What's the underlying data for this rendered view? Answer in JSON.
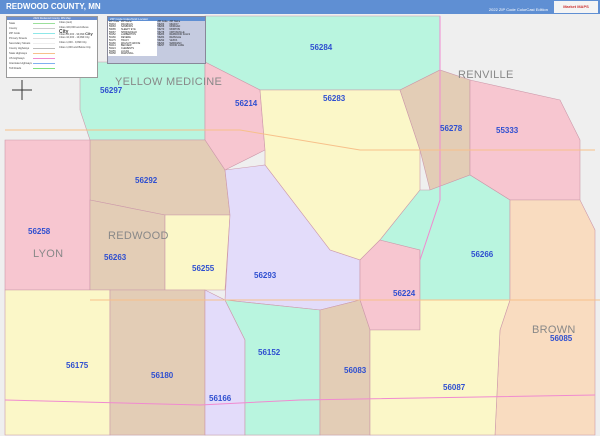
{
  "header": {
    "title": "REDWOOD COUNTY, MN",
    "edition": "2022 ZIP Code ColorCast Edition",
    "logo": "Market MAPS"
  },
  "legend": {
    "title": "2022 Redwood County, MN Map",
    "items": [
      {
        "label": "State",
        "color": "#9be09b"
      },
      {
        "label": "County",
        "color": "#cccccc"
      },
      {
        "label": "ZIP Code",
        "color": "#8ee8e8"
      },
      {
        "label": "Primary Streets",
        "color": "#dddddd"
      },
      {
        "label": "Secondary Streets",
        "color": "#eeeeee"
      },
      {
        "label": "County Highways",
        "color": "#bbbbbb"
      },
      {
        "label": "State Highways",
        "color": "#f7c08a"
      },
      {
        "label": "US Highways",
        "color": "#f08ad0"
      },
      {
        "label": "Interstate Highways",
        "color": "#7fb0f0"
      },
      {
        "label": "Toll Roads",
        "color": "#7fe07f"
      }
    ],
    "cities": [
      {
        "label": "Cities (text)",
        "sample": ""
      },
      {
        "label": "Cities 100,000 and Above",
        "sample": "City"
      },
      {
        "label": "Cities 20,000 - 99,999",
        "sample": "City"
      },
      {
        "label": "Cities 10,000 - 19,999",
        "sample": "City"
      },
      {
        "label": "Cities 1,000 - 9,999",
        "sample": "City"
      },
      {
        "label": "Cities 1,000 and Below",
        "sample": "City"
      }
    ]
  },
  "zip_table": {
    "title": "ZIP Code Index/Grid Locator",
    "headers": [
      "ZIP Code",
      "ZIP Name"
    ],
    "left": [
      [
        "55333",
        "FRANKLIN"
      ],
      [
        "56083",
        "SANBORN"
      ],
      [
        "56085",
        "SLEEPY EYE"
      ],
      [
        "56087",
        "SPRINGFIELD"
      ],
      [
        "56152",
        "LAMBERTON"
      ],
      [
        "56166",
        "REVERE"
      ],
      [
        "56175",
        "TRACY"
      ],
      [
        "56180",
        "WALNUT GROVE"
      ],
      [
        "56214",
        "BELVIEW"
      ],
      [
        "56224",
        "CLEMENTS"
      ],
      [
        "56255",
        "LUCAN"
      ],
      [
        "56258",
        "MARSHALL"
      ]
    ],
    "right": [
      [
        "56263",
        "MILROY"
      ],
      [
        "56266",
        "MORGAN"
      ],
      [
        "56270",
        "MORTON"
      ],
      [
        "56278",
        "ORTONVILLE"
      ],
      [
        "56283",
        "REDWOOD FALLS"
      ],
      [
        "56284",
        "RENVILLE"
      ],
      [
        "56292",
        "VESTA"
      ],
      [
        "56293",
        "WABASSO"
      ],
      [
        "56297",
        "WOOD LAKE"
      ]
    ]
  },
  "counties": [
    "YELLOW MEDICINE",
    "RENVILLE",
    "REDWOOD",
    "LYON",
    "BROWN"
  ],
  "zips": [
    "56284",
    "56297",
    "56214",
    "56283",
    "56278",
    "55333",
    "56292",
    "56258",
    "56263",
    "56255",
    "56293",
    "56266",
    "56224",
    "56085",
    "56175",
    "56180",
    "56152",
    "56083",
    "56087",
    "56166"
  ]
}
